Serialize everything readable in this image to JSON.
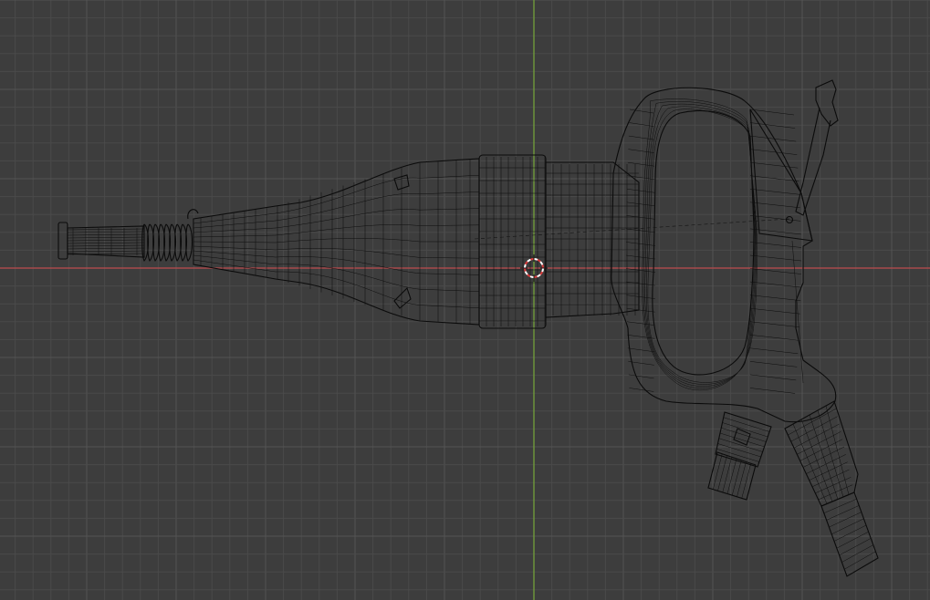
{
  "viewport": {
    "background": "#3d3d3d",
    "grid_minor_color": "#4a4a4a",
    "grid_major_color": "#545454",
    "x_axis_color": "#a84a4c",
    "y_axis_color": "#6f9a3b",
    "wire_color": "#0b0b0b",
    "cursor_colors": [
      "#ffffff",
      "#d93a3a"
    ]
  },
  "scene": {
    "object": "jackhammer-wireframe",
    "cursor_icon": "3d-cursor-icon"
  }
}
